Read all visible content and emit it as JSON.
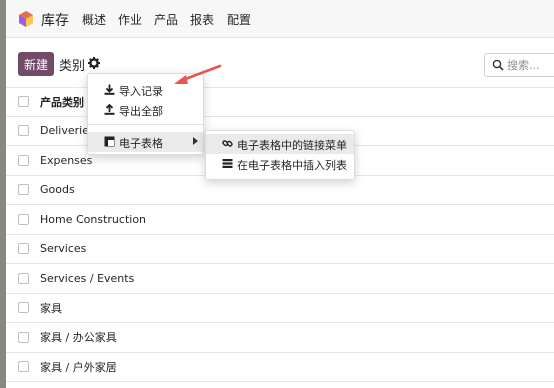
{
  "app": {
    "name": "库存"
  },
  "nav": [
    "概述",
    "作业",
    "产品",
    "报表",
    "配置"
  ],
  "toolbar": {
    "new_label": "新建",
    "breadcrumb": "类别"
  },
  "search": {
    "placeholder": "搜索..."
  },
  "table": {
    "header": "产品类别",
    "rows": [
      "Deliveries",
      "Expenses",
      "Goods",
      "Home Construction",
      "Services",
      "Services / Events",
      "家具",
      "家具 / 办公家具",
      "家具 / 户外家居"
    ]
  },
  "menu": {
    "import": "导入记录",
    "export": "导出全部",
    "spreadsheet": "电子表格"
  },
  "submenu": {
    "link": "电子表格中的链接菜单",
    "insert": "在电子表格中插入列表"
  },
  "colors": {
    "brand": "#714b67",
    "annotation": "#e8544f"
  }
}
